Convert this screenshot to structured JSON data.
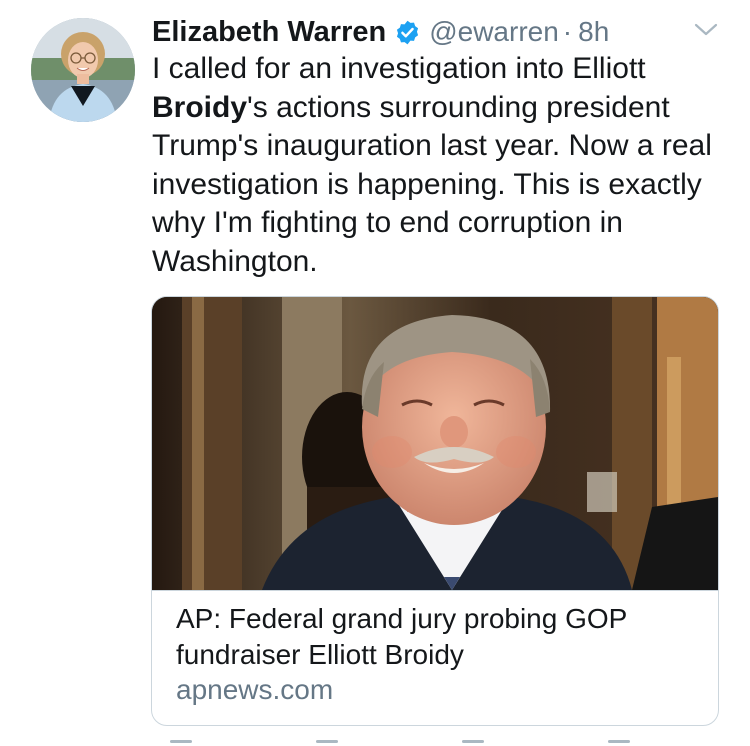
{
  "tweet": {
    "author_name": "Elizabeth Warren",
    "handle": "@ewarren",
    "separator": "·",
    "time": "8h",
    "text_part1": "I called for an investigation into Elliott ",
    "text_bold": "Broidy",
    "text_part2": "'s actions surrounding president Trump's inauguration last year. Now a real investigation is happening. This is exactly why I'm fighting to end corruption in Washington."
  },
  "card": {
    "title": "AP: Federal grand jury probing GOP fundraiser Elliott Broidy",
    "domain": "apnews.com"
  },
  "icons": {
    "verified": "verified-badge-icon",
    "more": "chevron-down-icon"
  },
  "colors": {
    "verified_blue": "#1da1f2",
    "secondary_text": "#657786",
    "primary_text": "#14171a",
    "border": "#ccd6dd"
  }
}
